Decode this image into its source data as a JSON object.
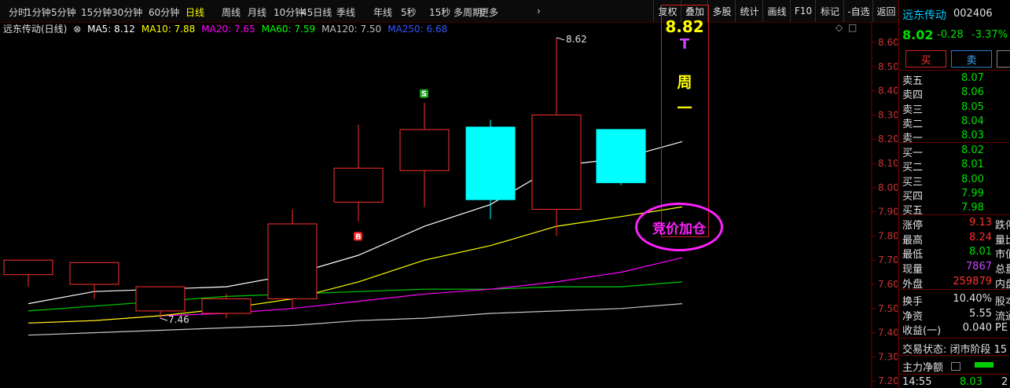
{
  "toolbar": {
    "periods": [
      "分时",
      "1分钟",
      "5分钟",
      "15分钟",
      "30分钟",
      "60分钟",
      "日线",
      "周线",
      "月线",
      "10分钟",
      "45日线",
      "季线",
      "年线",
      "5秒",
      "15秒",
      "多周期",
      "更多"
    ],
    "more_arrow": "›",
    "right_buttons": [
      "复权",
      "叠加",
      "多股",
      "统计",
      "画线",
      "F10",
      "标记",
      "-自选",
      "返回"
    ]
  },
  "chart_header": {
    "stock_title": "远东传动(日线)",
    "mas": [
      {
        "label": "MA5: 8.12",
        "color": "#ffffff"
      },
      {
        "label": "MA10: 7.88",
        "color": "#ffff00"
      },
      {
        "label": "MA20: 7.65",
        "color": "#ff00ff"
      },
      {
        "label": "MA60: 7.59",
        "color": "#00ff00"
      },
      {
        "label": "MA120: 7.50",
        "color": "#c0c0c0"
      },
      {
        "label": "MA250: 6.68",
        "color": "#3355ff"
      }
    ],
    "icons": [
      "◇",
      "□"
    ]
  },
  "chart_data": {
    "type": "candlestick",
    "ylim": [
      7.2,
      8.68
    ],
    "yticks": [
      "8.60",
      "8.50",
      "8.40",
      "8.30",
      "8.20",
      "8.10",
      "8.00",
      "7.90",
      "7.80",
      "7.70",
      "7.60",
      "7.50",
      "7.40",
      "7.30",
      "7.20"
    ],
    "candles": [
      {
        "open": 7.64,
        "high": 7.7,
        "low": 7.59,
        "close": 7.7
      },
      {
        "open": 7.6,
        "high": 7.69,
        "low": 7.54,
        "close": 7.69
      },
      {
        "open": 7.49,
        "high": 7.59,
        "low": 7.46,
        "close": 7.59
      },
      {
        "open": 7.48,
        "high": 7.56,
        "low": 7.46,
        "close": 7.54
      },
      {
        "open": 7.54,
        "high": 7.91,
        "low": 7.5,
        "close": 7.85
      },
      {
        "open": 7.94,
        "high": 8.26,
        "low": 7.86,
        "close": 8.08
      },
      {
        "open": 8.07,
        "high": 8.35,
        "low": 7.92,
        "close": 8.24
      },
      {
        "open": 8.25,
        "high": 8.28,
        "low": 7.87,
        "close": 7.95
      },
      {
        "open": 7.91,
        "high": 8.62,
        "low": 7.8,
        "close": 8.3
      },
      {
        "open": 8.24,
        "high": 8.24,
        "low": 8.01,
        "close": 8.02
      }
    ],
    "ma": {
      "ma5": [
        7.52,
        7.57,
        7.58,
        7.59,
        7.64,
        7.72,
        7.84,
        7.93,
        8.09,
        8.12,
        8.19
      ],
      "ma10": [
        7.44,
        7.45,
        7.47,
        7.5,
        7.54,
        7.61,
        7.7,
        7.76,
        7.84,
        7.88,
        7.92
      ],
      "ma20": [
        7.44,
        7.45,
        7.47,
        7.48,
        7.5,
        7.53,
        7.56,
        7.58,
        7.61,
        7.65,
        7.71
      ],
      "ma60": [
        7.49,
        7.51,
        7.53,
        7.55,
        7.56,
        7.57,
        7.58,
        7.58,
        7.59,
        7.59,
        7.61
      ],
      "ma120": [
        7.39,
        7.4,
        7.41,
        7.42,
        7.43,
        7.45,
        7.46,
        7.48,
        7.49,
        7.5,
        7.52
      ]
    },
    "annotations": {
      "high_label": "8.62",
      "low_label": "7.46",
      "buy_marker": "B",
      "sell_marker": "S"
    }
  },
  "overlay": {
    "price": "8.82",
    "text1": "T",
    "text2": "周",
    "text3": "一",
    "ellipse_text": "竞价加仓"
  },
  "quote": {
    "name": "远东传动",
    "code": "002406",
    "price": "8.02",
    "change": "-0.28",
    "change_pct": "-3.37%",
    "buy_btn": "买",
    "sell_btn": "卖",
    "asks": [
      {
        "label": "卖五",
        "price": "8.07"
      },
      {
        "label": "卖四",
        "price": "8.06"
      },
      {
        "label": "卖三",
        "price": "8.05"
      },
      {
        "label": "卖二",
        "price": "8.04"
      },
      {
        "label": "卖一",
        "price": "8.03"
      }
    ],
    "bids": [
      {
        "label": "买一",
        "price": "8.02"
      },
      {
        "label": "买二",
        "price": "8.01"
      },
      {
        "label": "买三",
        "price": "8.00"
      },
      {
        "label": "买四",
        "price": "7.99"
      },
      {
        "label": "买五",
        "price": "7.98"
      }
    ],
    "stats": [
      {
        "label": "涨停",
        "value": "9.13",
        "value_color": "#ff3030",
        "right": "跌停"
      },
      {
        "label": "最高",
        "value": "8.24",
        "value_color": "#ff3030",
        "right": "量比"
      },
      {
        "label": "最低",
        "value": "8.01",
        "value_color": "#00e000",
        "right": "市值"
      },
      {
        "label": "现量",
        "value": "7867",
        "value_color": "#cc44ff",
        "right": "总量"
      },
      {
        "label": "外盘",
        "value": "259879",
        "value_color": "#ff3030",
        "right": "内盘"
      }
    ],
    "stats2": [
      {
        "label": "换手",
        "value": "10.40%",
        "right": "股本"
      },
      {
        "label": "净资",
        "value": "5.55",
        "right": "流通"
      },
      {
        "label": "收益(一)",
        "value": "0.040",
        "right": "PE"
      }
    ],
    "trade_status": "交易状态: 闭市阶段 15",
    "main_flow": "主力净额",
    "tick_time": "14:55",
    "tick_price": "8.03",
    "tick_vol": "2"
  }
}
